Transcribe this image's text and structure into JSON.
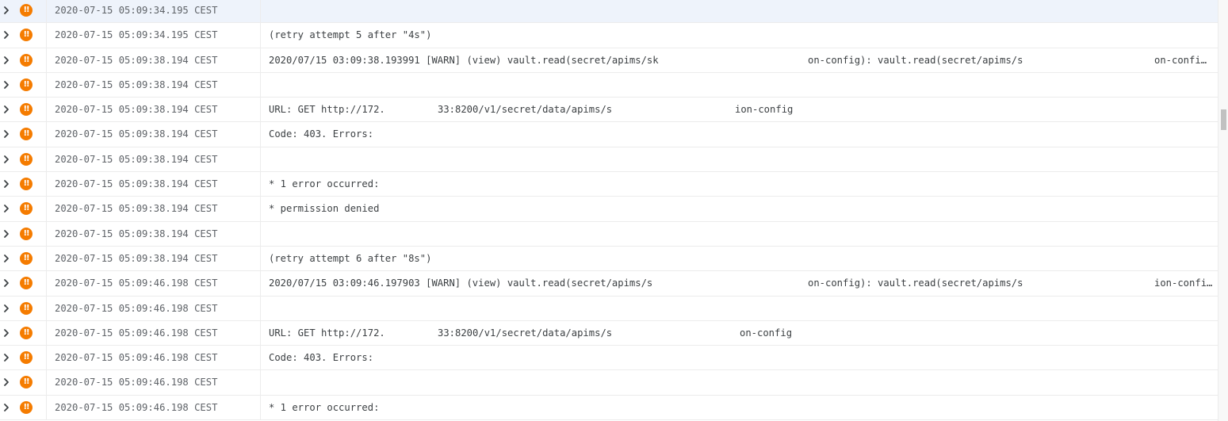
{
  "colors": {
    "severity_warning": "#f57c00",
    "selected_row_bg": "#eef3fb",
    "timestamp_text": "#5f6368",
    "message_text": "#3c4043"
  },
  "icons": {
    "expand": "chevron-right-icon",
    "severity": "warning-severity-icon"
  },
  "log_rows": [
    {
      "timestamp": "2020-07-15 05:09:34.195 CEST",
      "message": "",
      "selected": true
    },
    {
      "timestamp": "2020-07-15 05:09:34.195 CEST",
      "message": "(retry attempt 5 after \"4s\")"
    },
    {
      "timestamp": "2020-07-15 05:09:38.194 CEST",
      "message": "",
      "segments": [
        {
          "text": "2020/07/15 03:09:38.193991 [WARN] (view) vault.read(secret/apims/sk"
        },
        {
          "text": "on-config): vault.read(secret/apims/s"
        },
        {
          "text": "on-confi…"
        }
      ]
    },
    {
      "timestamp": "2020-07-15 05:09:38.194 CEST",
      "message": ""
    },
    {
      "timestamp": "2020-07-15 05:09:38.194 CEST",
      "message": "",
      "segments": [
        {
          "text": "URL: GET http://172."
        },
        {
          "text": "33:8200/v1/secret/data/apims/s"
        },
        {
          "text": "ion-config"
        }
      ]
    },
    {
      "timestamp": "2020-07-15 05:09:38.194 CEST",
      "message": "Code: 403. Errors:"
    },
    {
      "timestamp": "2020-07-15 05:09:38.194 CEST",
      "message": ""
    },
    {
      "timestamp": "2020-07-15 05:09:38.194 CEST",
      "message": "* 1 error occurred:"
    },
    {
      "timestamp": "2020-07-15 05:09:38.194 CEST",
      "message": "* permission denied"
    },
    {
      "timestamp": "2020-07-15 05:09:38.194 CEST",
      "message": ""
    },
    {
      "timestamp": "2020-07-15 05:09:38.194 CEST",
      "message": "(retry attempt 6 after \"8s\")"
    },
    {
      "timestamp": "2020-07-15 05:09:46.198 CEST",
      "message": "",
      "segments": [
        {
          "text": "2020/07/15 03:09:46.197903 [WARN] (view) vault.read(secret/apims/s"
        },
        {
          "text": "on-config): vault.read(secret/apims/s"
        },
        {
          "text": "ion-confi…"
        }
      ]
    },
    {
      "timestamp": "2020-07-15 05:09:46.198 CEST",
      "message": ""
    },
    {
      "timestamp": "2020-07-15 05:09:46.198 CEST",
      "message": "",
      "segments": [
        {
          "text": "URL: GET http://172."
        },
        {
          "text": "33:8200/v1/secret/data/apims/s"
        },
        {
          "text": "on-config"
        }
      ]
    },
    {
      "timestamp": "2020-07-15 05:09:46.198 CEST",
      "message": "Code: 403. Errors:"
    },
    {
      "timestamp": "2020-07-15 05:09:46.198 CEST",
      "message": ""
    },
    {
      "timestamp": "2020-07-15 05:09:46.198 CEST",
      "message": "* 1 error occurred:"
    }
  ]
}
